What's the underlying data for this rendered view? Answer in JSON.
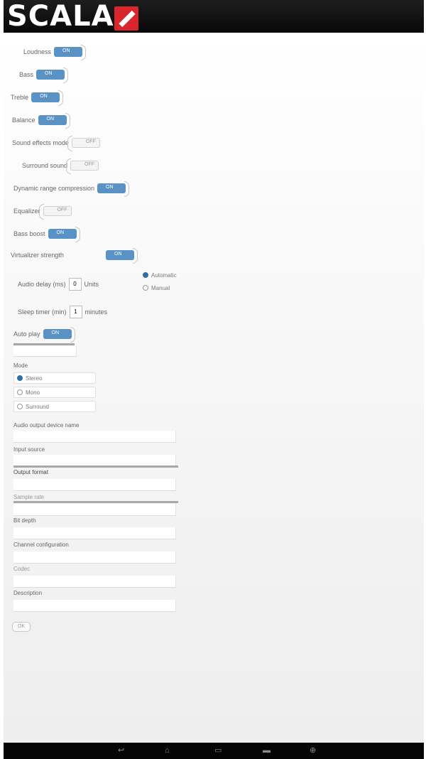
{
  "brand": {
    "logo_text": "SCALA"
  },
  "toggles": [
    {
      "label": "Loudness",
      "state": "ON"
    },
    {
      "label": "Bass",
      "state": "ON"
    },
    {
      "label": "Treble",
      "state": "ON"
    },
    {
      "label": "Balance",
      "state": "ON"
    },
    {
      "label": "Sound effects mode",
      "state": "OFF"
    },
    {
      "label": "Surround sound",
      "state": "OFF"
    },
    {
      "label": "Dynamic range compression",
      "state": "ON"
    },
    {
      "label": "Equalizer",
      "state": "OFF"
    },
    {
      "label": "Bass boost",
      "state": "ON"
    },
    {
      "label": "Virtualizer strength",
      "state": "ON"
    }
  ],
  "delay_row": {
    "label": "Audio delay (ms)",
    "value": "0",
    "unit_label": "Units",
    "options": [
      "Automatic",
      "Manual"
    ],
    "selected": "Automatic"
  },
  "timer_row": {
    "label": "Sleep timer (min)",
    "value": "1",
    "suffix": "minutes"
  },
  "autoplay": {
    "label": "Auto play",
    "state": "ON"
  },
  "mode": {
    "label": "Mode",
    "options": [
      "Stereo",
      "Mono",
      "Surround"
    ],
    "selected": "Stereo"
  },
  "fields": [
    {
      "label": "Audio output device name"
    },
    {
      "label": "Input source"
    },
    {
      "label": "Output format"
    },
    {
      "label": "Sample rate"
    },
    {
      "label": "Bit depth"
    },
    {
      "label": "Channel configuration"
    },
    {
      "label": "Codec"
    },
    {
      "label": "Description"
    }
  ],
  "save_label": "OK",
  "navbar": {
    "icons": [
      "back-icon",
      "home-icon",
      "recent-apps-icon",
      "menu-icon",
      "screenshot-icon"
    ]
  }
}
